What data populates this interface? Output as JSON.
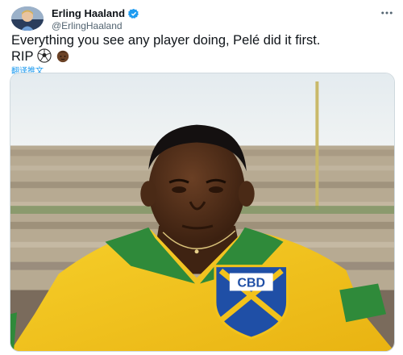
{
  "author": {
    "display_name": "Erling Haaland",
    "handle": "@ErlingHaaland",
    "verified": true
  },
  "tweet": {
    "text_line1": "Everything you see any player doing, Pelé did it first.",
    "text_line2": "RIP",
    "emojis": [
      "soccer-ball-icon",
      "man-dark-skin-emoji"
    ]
  },
  "translate_label": "翻译推文",
  "photo": {
    "crest_text": "CBD"
  },
  "colors": {
    "accent": "#1d9bf0",
    "jersey_yellow": "#f2c21b",
    "collar_green": "#2f8a3a",
    "crest_blue": "#1f4fa6"
  }
}
